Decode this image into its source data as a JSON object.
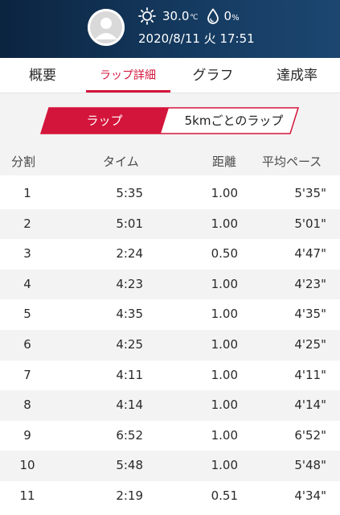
{
  "header": {
    "weather_icon": "sun-icon",
    "temperature": "30.0",
    "temperature_unit": "℃",
    "humidity_icon": "water-drop-icon",
    "humidity": "0",
    "humidity_unit": "%",
    "datetime": "2020/8/11 火 17:51",
    "avatar_icon": "user-avatar-icon"
  },
  "tabs": [
    {
      "label": "概要"
    },
    {
      "label": "ラップ詳細",
      "active": true
    },
    {
      "label": "グラフ"
    },
    {
      "label": "達成率"
    }
  ],
  "segment": {
    "left": "ラップ",
    "right": "5kmごとのラップ",
    "selected": "left"
  },
  "table": {
    "headers": [
      "分割",
      "タイム",
      "距離",
      "平均ペース"
    ],
    "rows": [
      [
        "1",
        "5:35",
        "1.00",
        "5'35\""
      ],
      [
        "2",
        "5:01",
        "1.00",
        "5'01\""
      ],
      [
        "3",
        "2:24",
        "0.50",
        "4'47\""
      ],
      [
        "4",
        "4:23",
        "1.00",
        "4'23\""
      ],
      [
        "5",
        "4:35",
        "1.00",
        "4'35\""
      ],
      [
        "6",
        "4:25",
        "1.00",
        "4'25\""
      ],
      [
        "7",
        "4:11",
        "1.00",
        "4'11\""
      ],
      [
        "8",
        "4:14",
        "1.00",
        "4'14\""
      ],
      [
        "9",
        "6:52",
        "1.00",
        "6'52\""
      ],
      [
        "10",
        "5:48",
        "1.00",
        "5'48\""
      ],
      [
        "11",
        "2:19",
        "0.51",
        "4'34\""
      ]
    ]
  },
  "colors": {
    "accent": "#d4153b",
    "header_bg": "#153a60",
    "stripe": "#f3f3f3"
  }
}
